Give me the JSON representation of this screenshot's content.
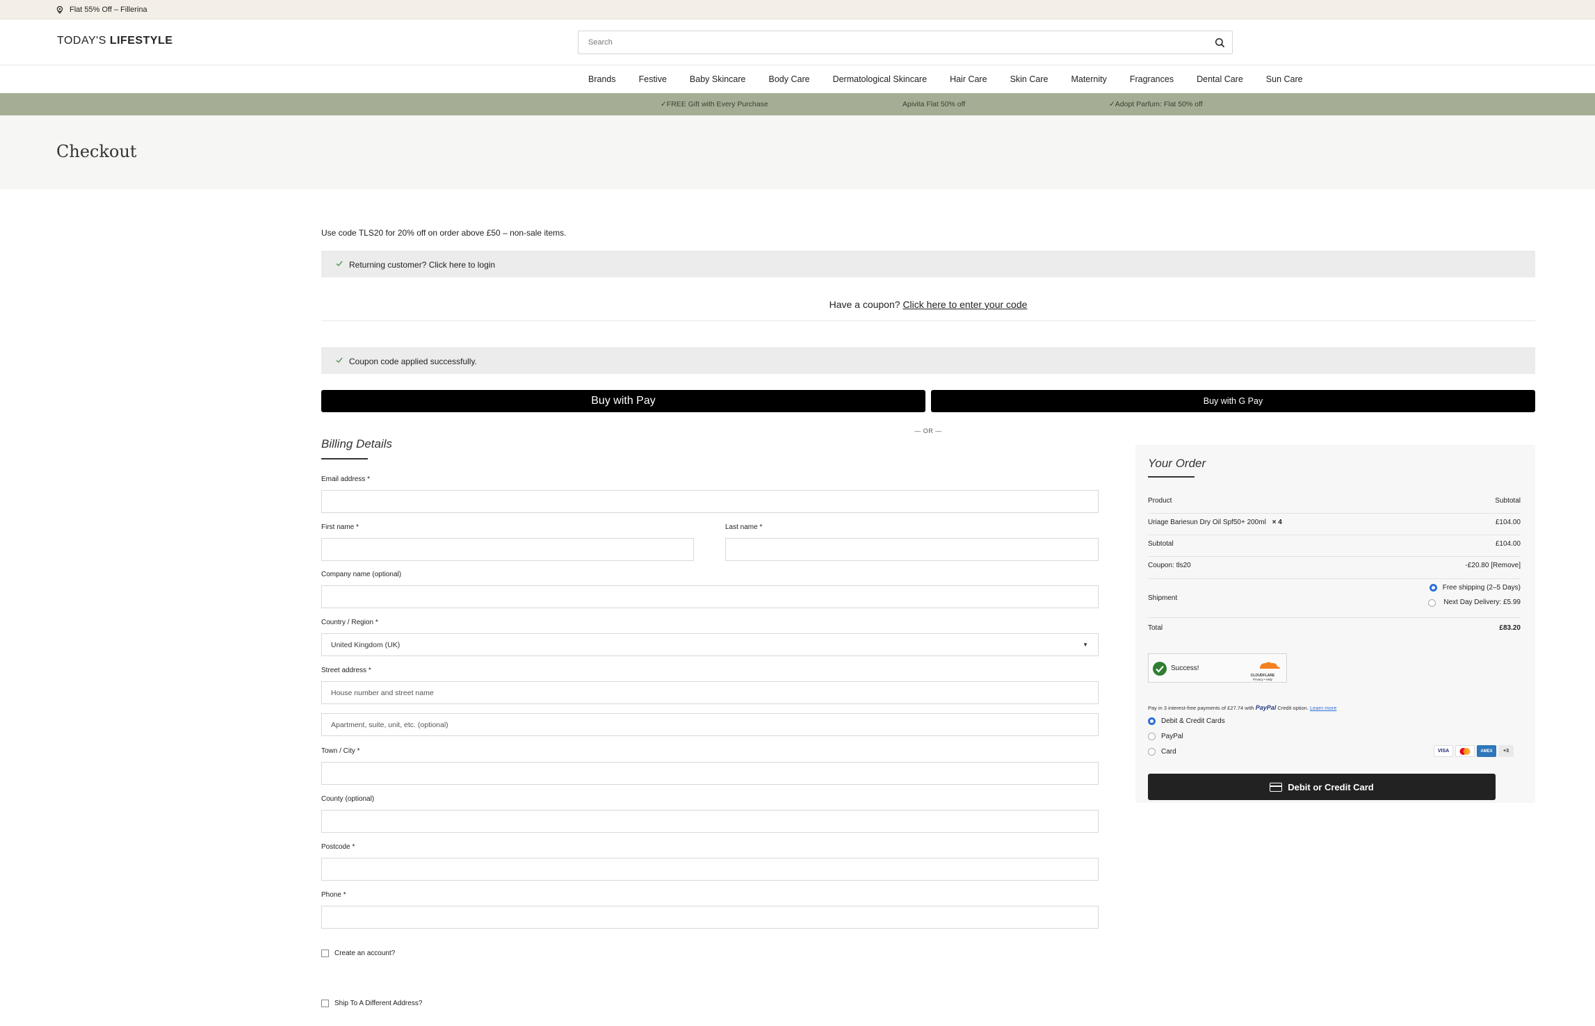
{
  "topbar": {
    "promo": "Flat 55% Off – Fillerina"
  },
  "header": {
    "logo_light": "TODAY'S ",
    "logo_bold": "LIFESTYLE",
    "search_placeholder": "Search"
  },
  "nav": {
    "items": [
      "Brands",
      "Festive",
      "Baby Skincare",
      "Body Care",
      "Dermatological Skincare",
      "Hair Care",
      "Skin Care",
      "Maternity",
      "Fragrances",
      "Dental Care",
      "Sun Care"
    ]
  },
  "offers": {
    "items": [
      "✓FREE Gift with Every Purchase",
      "Apivita Flat 50% off",
      "✓Adopt Parfum: Flat 50% off"
    ]
  },
  "page": {
    "title": "Checkout"
  },
  "notices": {
    "code_text": "Use code TLS20 for 20% off on order above £50 – non-sale items.",
    "returning": "Returning customer? Click here to login",
    "coupon_prompt": "Have a coupon?",
    "coupon_link": "Click here to enter your code",
    "coupon_applied": "Coupon code applied successfully."
  },
  "express": {
    "apple_label": "Buy with  Pay",
    "gpay_label": "Buy with G Pay",
    "or": "— OR —"
  },
  "billing": {
    "title": "Billing Details",
    "email_label": "Email address *",
    "first_name_label": "First name *",
    "last_name_label": "Last name *",
    "company_label": "Company name (optional)",
    "country_label": "Country / Region *",
    "country_value": "United Kingdom (UK)",
    "street_label": "Street address *",
    "street1_placeholder": "House number and street name",
    "street2_placeholder": "Apartment, suite, unit, etc. (optional)",
    "town_label": "Town / City *",
    "county_label": "County (optional)",
    "postcode_label": "Postcode *",
    "phone_label": "Phone *",
    "create_account": "Create an account?",
    "ship_different": "Ship To A Different Address?"
  },
  "order": {
    "title": "Your Order",
    "product_header": "Product",
    "subtotal_header": "Subtotal",
    "item_name": "Uriage Bariesun Dry Oil Spf50+ 200ml",
    "item_qty": "× 4",
    "item_price": "£104.00",
    "subtotal_label": "Subtotal",
    "subtotal_value": "£104.00",
    "coupon_label": "Coupon: tls20",
    "coupon_value": "-£20.80 [Remove]",
    "shipment_label": "Shipment",
    "ship_option_1": "Free shipping (2–5 Days)",
    "ship_option_2": "Next Day Delivery: £5.99",
    "total_label": "Total",
    "total_value": "£83.20",
    "captcha_text": "Success!",
    "captcha_brand": "CLOUDFLARE",
    "captcha_links": "Privacy • Help",
    "paypal_text": "Pay in 3 interest-free payments of £27.74 with",
    "paypal_brand": "PayPal",
    "paypal_credit": "Credit option.",
    "paypal_learn": "Learn more",
    "pm_1": "Debit & Credit Cards",
    "pm_2": "PayPal",
    "pm_3": "Card",
    "card_visa": "VISA",
    "card_amex": "AMEX",
    "card_more": "+3",
    "pay_button": "Debit or Credit Card"
  }
}
